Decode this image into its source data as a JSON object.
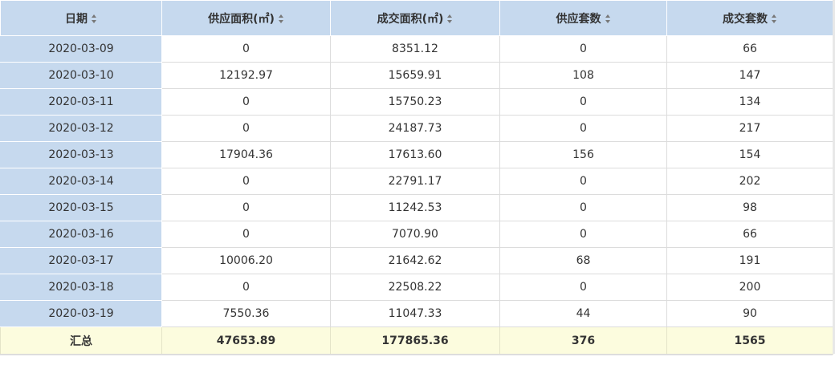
{
  "table": {
    "headers": [
      {
        "label": "日期"
      },
      {
        "label": "供应面积(㎡)"
      },
      {
        "label": "成交面积(㎡)"
      },
      {
        "label": "供应套数"
      },
      {
        "label": "成交套数"
      }
    ],
    "rows": [
      [
        "2020-03-09",
        "0",
        "8351.12",
        "0",
        "66"
      ],
      [
        "2020-03-10",
        "12192.97",
        "15659.91",
        "108",
        "147"
      ],
      [
        "2020-03-11",
        "0",
        "15750.23",
        "0",
        "134"
      ],
      [
        "2020-03-12",
        "0",
        "24187.73",
        "0",
        "217"
      ],
      [
        "2020-03-13",
        "17904.36",
        "17613.60",
        "156",
        "154"
      ],
      [
        "2020-03-14",
        "0",
        "22791.17",
        "0",
        "202"
      ],
      [
        "2020-03-15",
        "0",
        "11242.53",
        "0",
        "98"
      ],
      [
        "2020-03-16",
        "0",
        "7070.90",
        "0",
        "66"
      ],
      [
        "2020-03-17",
        "10006.20",
        "21642.62",
        "68",
        "191"
      ],
      [
        "2020-03-18",
        "0",
        "22508.22",
        "0",
        "200"
      ],
      [
        "2020-03-19",
        "7550.36",
        "11047.33",
        "44",
        "90"
      ]
    ],
    "total": [
      "汇总",
      "47653.89",
      "177865.36",
      "376",
      "1565"
    ]
  },
  "colors": {
    "header_bg": "#c6d9ee",
    "total_bg": "#fcfcde",
    "text": "#333333"
  },
  "icons": {
    "sort": "sort-icon"
  }
}
